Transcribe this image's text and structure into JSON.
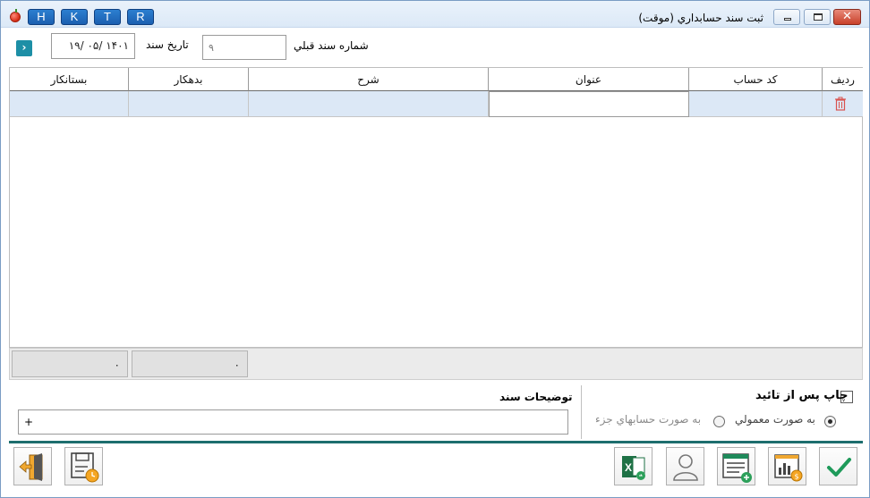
{
  "window": {
    "title": "ثبت سند حسابداري (موقت)",
    "quick_buttons": [
      "H",
      "K",
      "T",
      "R"
    ]
  },
  "header": {
    "prev_doc_label": "شماره سند قبلي",
    "prev_doc_placeholder": "۹",
    "doc_date_label": "تاريخ سند",
    "doc_date_value": "۱۴۰۱ /۰۵ /۱۹"
  },
  "grid": {
    "columns": [
      "رديف",
      "كد حساب",
      "عنوان",
      "شرح",
      "بدهكار",
      "بستانكار"
    ]
  },
  "totals": {
    "debit_total": "۰",
    "credit_total": "۰"
  },
  "options": {
    "print_after_confirm_label": "چاپ پس از تائيد",
    "radio_normal_label": "به صورت معمولي",
    "radio_detailed_label": "به صورت حسابهاي جزء",
    "doc_description_label": "توضيحات سند",
    "doc_description_value": "+"
  },
  "colors": {
    "accent": "#1d6e6e",
    "grid_row": "#dce8f6",
    "nav_button": "#1d8fa6"
  }
}
